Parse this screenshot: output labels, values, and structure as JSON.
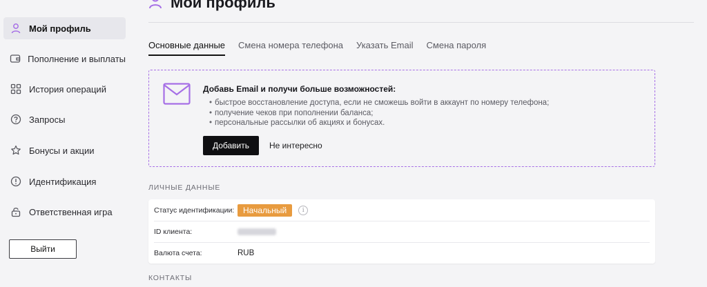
{
  "sidebar": {
    "items": [
      {
        "label": "Мой профиль",
        "icon": "user-icon",
        "active": true
      },
      {
        "label": "Пополнение и выплаты",
        "icon": "wallet-icon"
      },
      {
        "label": "История операций",
        "icon": "grid-icon"
      },
      {
        "label": "Запросы",
        "icon": "question-icon"
      },
      {
        "label": "Бонусы и акции",
        "icon": "star-icon"
      },
      {
        "label": "Идентификация",
        "icon": "alert-icon"
      },
      {
        "label": "Ответственная игра",
        "icon": "lock-icon"
      }
    ],
    "logout_label": "Выйти"
  },
  "header": {
    "title": "Мой профиль",
    "icon": "user-icon"
  },
  "tabs": [
    {
      "label": "Основные данные",
      "active": true
    },
    {
      "label": "Смена номера телефона"
    },
    {
      "label": "Указать Email"
    },
    {
      "label": "Смена пароля"
    }
  ],
  "promo": {
    "icon": "mail-icon",
    "title": "Добавь Email и получи больше возможностей:",
    "bullets": [
      "быстрое восстановление доступа, если не сможешь войти в аккаунт по номеру телефона;",
      "получение чеков при пополнении баланса;",
      "персональные рассылки об акциях и бонусах."
    ],
    "primary_button": "Добавить",
    "secondary_button": "Не интересно"
  },
  "personal": {
    "section_title": "Личные данные",
    "status_label": "Статус идентификации:",
    "status_value": "Начальный",
    "id_label": "ID клиента:",
    "currency_label": "Валюта счета:",
    "currency_value": "RUB"
  },
  "contacts": {
    "section_title": "Контакты"
  },
  "colors": {
    "accent": "#a66fe6",
    "badge": "#e89b3f",
    "primary_button": "#0f0f12"
  }
}
